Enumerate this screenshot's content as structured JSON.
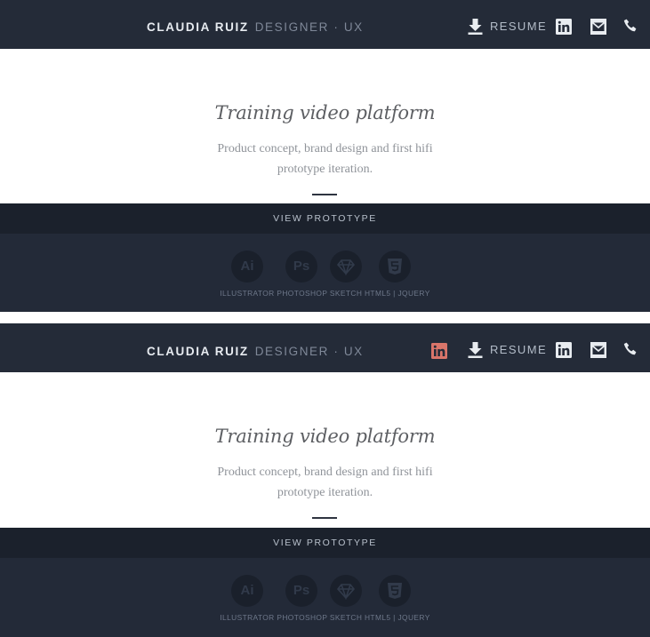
{
  "header": {
    "name": "CLAUDIA RUIZ",
    "role": "DESIGNER · UX",
    "resume_label": "RESUME",
    "icons": [
      "download-icon",
      "linkedin-icon",
      "mail-icon",
      "phone-icon"
    ],
    "highlight_icon": "linkedin-icon",
    "colors": {
      "bar": "#242b38",
      "highlight": "#d9756a"
    }
  },
  "project": {
    "title": "Training video platform",
    "description": "Product concept, brand design and first hifi prototype iteration.",
    "cta": "VIEW PROTOTYPE"
  },
  "tools": {
    "badges": [
      {
        "name": "illustrator-icon",
        "text": "Ai"
      },
      {
        "name": "photoshop-icon",
        "text": "Ps"
      },
      {
        "name": "sketch-icon",
        "text": ""
      },
      {
        "name": "html5-icon",
        "text": ""
      }
    ],
    "list": "ILLUSTRATOR PHOTOSHOP SKETCH HTML5 | JQUERY"
  }
}
